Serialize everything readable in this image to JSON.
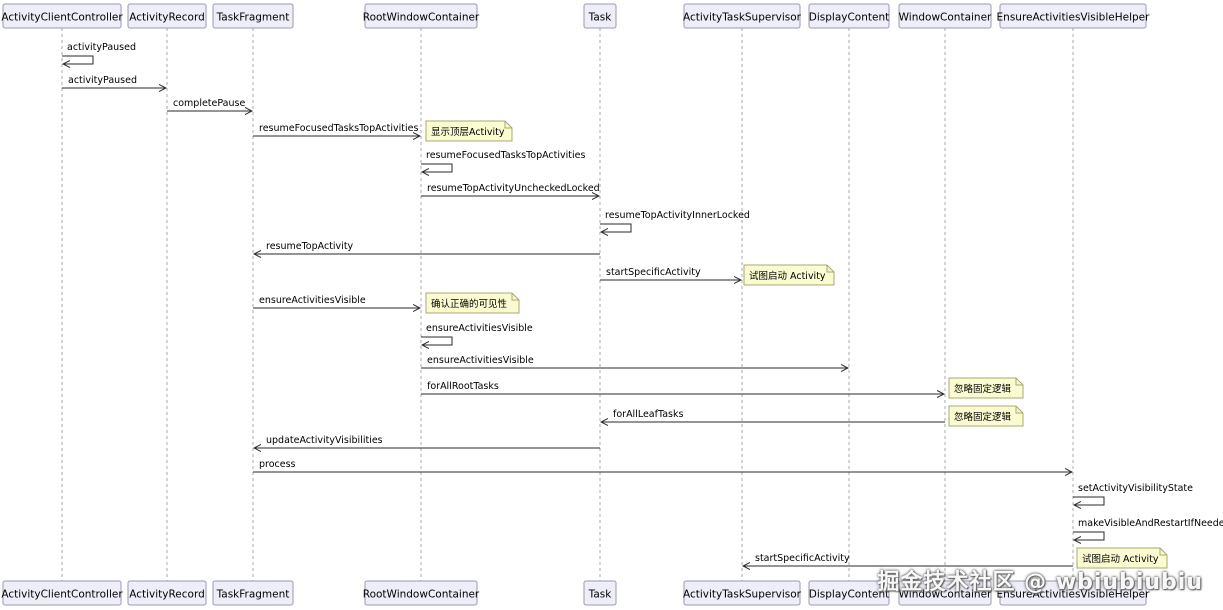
{
  "participants": [
    "ActivityClientController",
    "ActivityRecord",
    "TaskFragment",
    "RootWindowContainer",
    "Task",
    "ActivityTaskSupervisor",
    "DisplayContent",
    "WindowContainer",
    "EnsureActivitiesVisibleHelper"
  ],
  "messages": [
    {
      "from": 0,
      "to": 0,
      "label": "activityPaused"
    },
    {
      "from": 0,
      "to": 1,
      "label": "activityPaused"
    },
    {
      "from": 1,
      "to": 2,
      "label": "completePause"
    },
    {
      "from": 2,
      "to": 3,
      "label": "resumeFocusedTasksTopActivities"
    },
    {
      "from": 3,
      "to": 3,
      "label": "resumeFocusedTasksTopActivities"
    },
    {
      "from": 3,
      "to": 4,
      "label": "resumeTopActivityUncheckedLocked"
    },
    {
      "from": 4,
      "to": 4,
      "label": "resumeTopActivityInnerLocked"
    },
    {
      "from": 4,
      "to": 2,
      "label": "resumeTopActivity"
    },
    {
      "from": 4,
      "to": 5,
      "label": "startSpecificActivity"
    },
    {
      "from": 2,
      "to": 3,
      "label": "ensureActivitiesVisible"
    },
    {
      "from": 3,
      "to": 3,
      "label": "ensureActivitiesVisible"
    },
    {
      "from": 3,
      "to": 6,
      "label": "ensureActivitiesVisible"
    },
    {
      "from": 3,
      "to": 7,
      "label": "forAllRootTasks"
    },
    {
      "from": 7,
      "to": 4,
      "label": "forAllLeafTasks"
    },
    {
      "from": 4,
      "to": 2,
      "label": "updateActivityVisibilities"
    },
    {
      "from": 2,
      "to": 8,
      "label": "process"
    },
    {
      "from": 8,
      "to": 8,
      "label": "setActivityVisibilityState"
    },
    {
      "from": 8,
      "to": 8,
      "label": "makeVisibleAndRestartIfNeeded"
    },
    {
      "from": 8,
      "to": 5,
      "label": "startSpecificActivity"
    }
  ],
  "notes": [
    {
      "over": 3,
      "text": "显示顶层Activity"
    },
    {
      "over": 5,
      "text": "试图启动 Activity"
    },
    {
      "over": 3,
      "text": "确认正确的可见性"
    },
    {
      "over": 7,
      "text": "忽略固定逻辑"
    },
    {
      "over": 7,
      "text": "忽略固定逻辑"
    },
    {
      "over": 8,
      "text": "试图启动 Activity"
    }
  ],
  "watermark": "掘金技术社区 @ wbiubiubiu",
  "colors": {
    "participant_fill": "#eeeef9",
    "participant_border": "#9a9ab0",
    "lifeline": "#a8a8a8",
    "arrow": "#2a2a2a",
    "note_fill": "#fbfbd2",
    "note_border": "#a8a870"
  }
}
